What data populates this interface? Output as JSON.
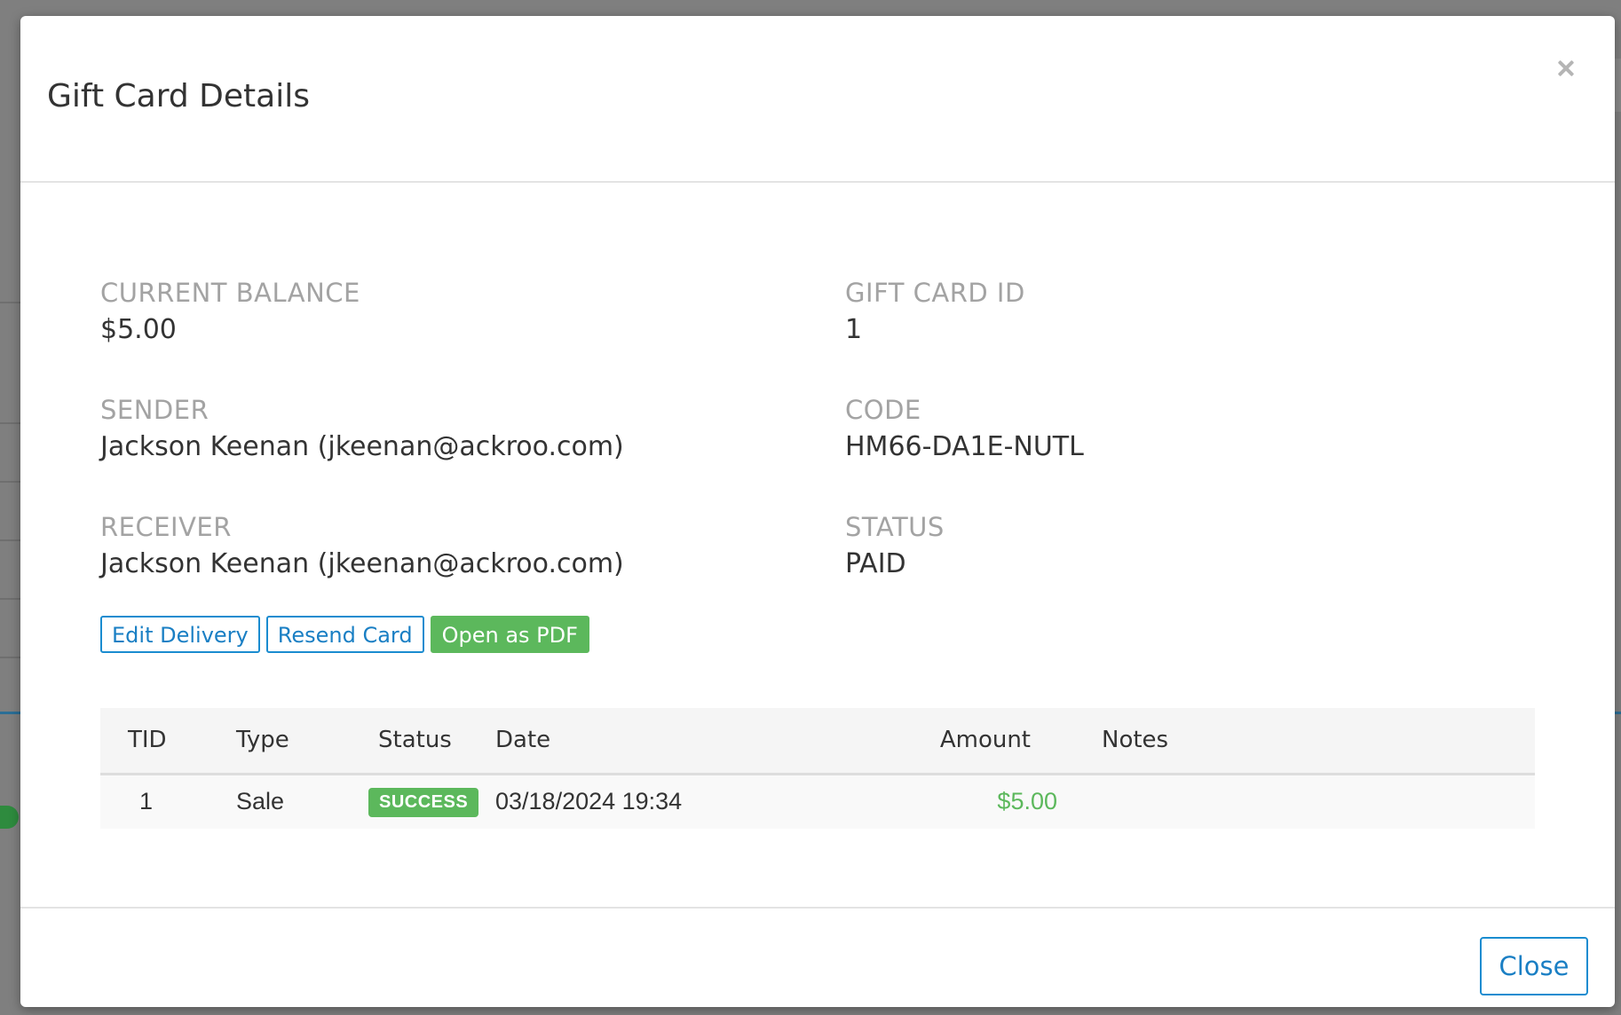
{
  "modal": {
    "title": "Gift Card Details",
    "close_icon": "close-icon"
  },
  "details": {
    "current_balance": {
      "label": "CURRENT BALANCE",
      "value": "$5.00"
    },
    "gift_card_id": {
      "label": "GIFT CARD ID",
      "value": "1"
    },
    "sender": {
      "label": "SENDER",
      "value": "Jackson Keenan (jkeenan@ackroo.com)"
    },
    "code": {
      "label": "CODE",
      "value": "HM66-DA1E-NUTL"
    },
    "receiver": {
      "label": "RECEIVER",
      "value": "Jackson Keenan (jkeenan@ackroo.com)"
    },
    "status": {
      "label": "STATUS",
      "value": "PAID"
    }
  },
  "actions": {
    "edit_delivery": "Edit Delivery",
    "resend_card": "Resend Card",
    "open_pdf": "Open as PDF"
  },
  "transactions": {
    "headers": [
      "TID",
      "Type",
      "Status",
      "Date",
      "Amount",
      "Notes"
    ],
    "rows": [
      {
        "tid": "1",
        "type": "Sale",
        "status": "SUCCESS",
        "date": "03/18/2024 19:34",
        "amount": "$5.00",
        "notes": ""
      }
    ]
  },
  "footer": {
    "close_label": "Close"
  },
  "colors": {
    "accent": "#1a8cd0",
    "success": "#5cb85c",
    "backdrop": "#7f7f7f"
  }
}
